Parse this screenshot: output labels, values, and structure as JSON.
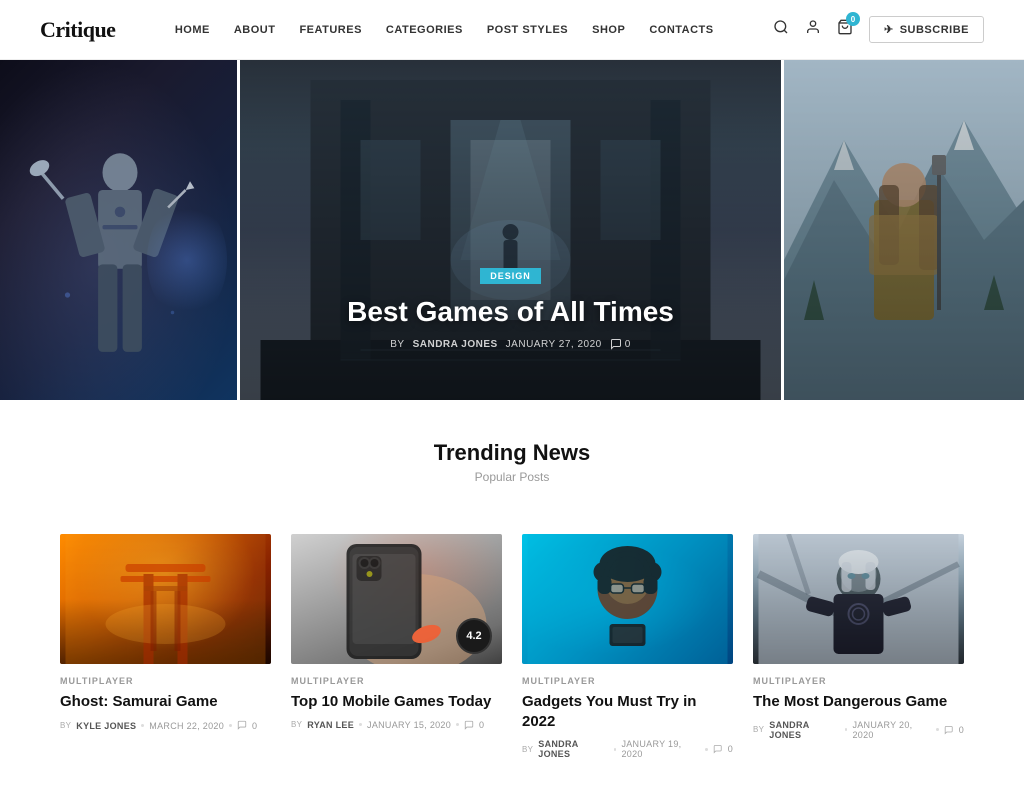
{
  "header": {
    "logo": "Critique",
    "nav": [
      {
        "label": "Home",
        "id": "nav-home"
      },
      {
        "label": "About",
        "id": "nav-about"
      },
      {
        "label": "Features",
        "id": "nav-features"
      },
      {
        "label": "Categories",
        "id": "nav-categories"
      },
      {
        "label": "Post Styles",
        "id": "nav-post-styles"
      },
      {
        "label": "Shop",
        "id": "nav-shop"
      },
      {
        "label": "Contacts",
        "id": "nav-contacts"
      }
    ],
    "cart_count": "0",
    "subscribe_label": "Subscribe"
  },
  "hero": {
    "center_badge": "Design",
    "center_title": "Best Games of All Times",
    "center_author": "Sandra Jones",
    "center_date": "January 27, 2020",
    "center_comments": "0"
  },
  "trending": {
    "title": "Trending News",
    "subtitle": "Popular Posts"
  },
  "cards": [
    {
      "id": "card-1",
      "category": "Multiplayer",
      "title": "Ghost: Samurai Game",
      "author": "Kyle Jones",
      "date": "March 22, 2020",
      "comments": "0",
      "img_class": "card-img-1"
    },
    {
      "id": "card-2",
      "category": "Multiplayer",
      "title": "Top 10 Mobile Games Today",
      "author": "Ryan Lee",
      "date": "January 15, 2020",
      "comments": "0",
      "rating": "4.2",
      "img_class": "card-img-2"
    },
    {
      "id": "card-3",
      "category": "Multiplayer",
      "title": "Gadgets You Must Try in 2022",
      "author": "Sandra Jones",
      "date": "January 19, 2020",
      "comments": "0",
      "img_class": "card-img-3"
    },
    {
      "id": "card-4",
      "category": "Multiplayer",
      "title": "The Most Dangerous Game",
      "author": "Sandra Jones",
      "date": "January 20, 2020",
      "comments": "0",
      "img_class": "card-img-4"
    }
  ]
}
